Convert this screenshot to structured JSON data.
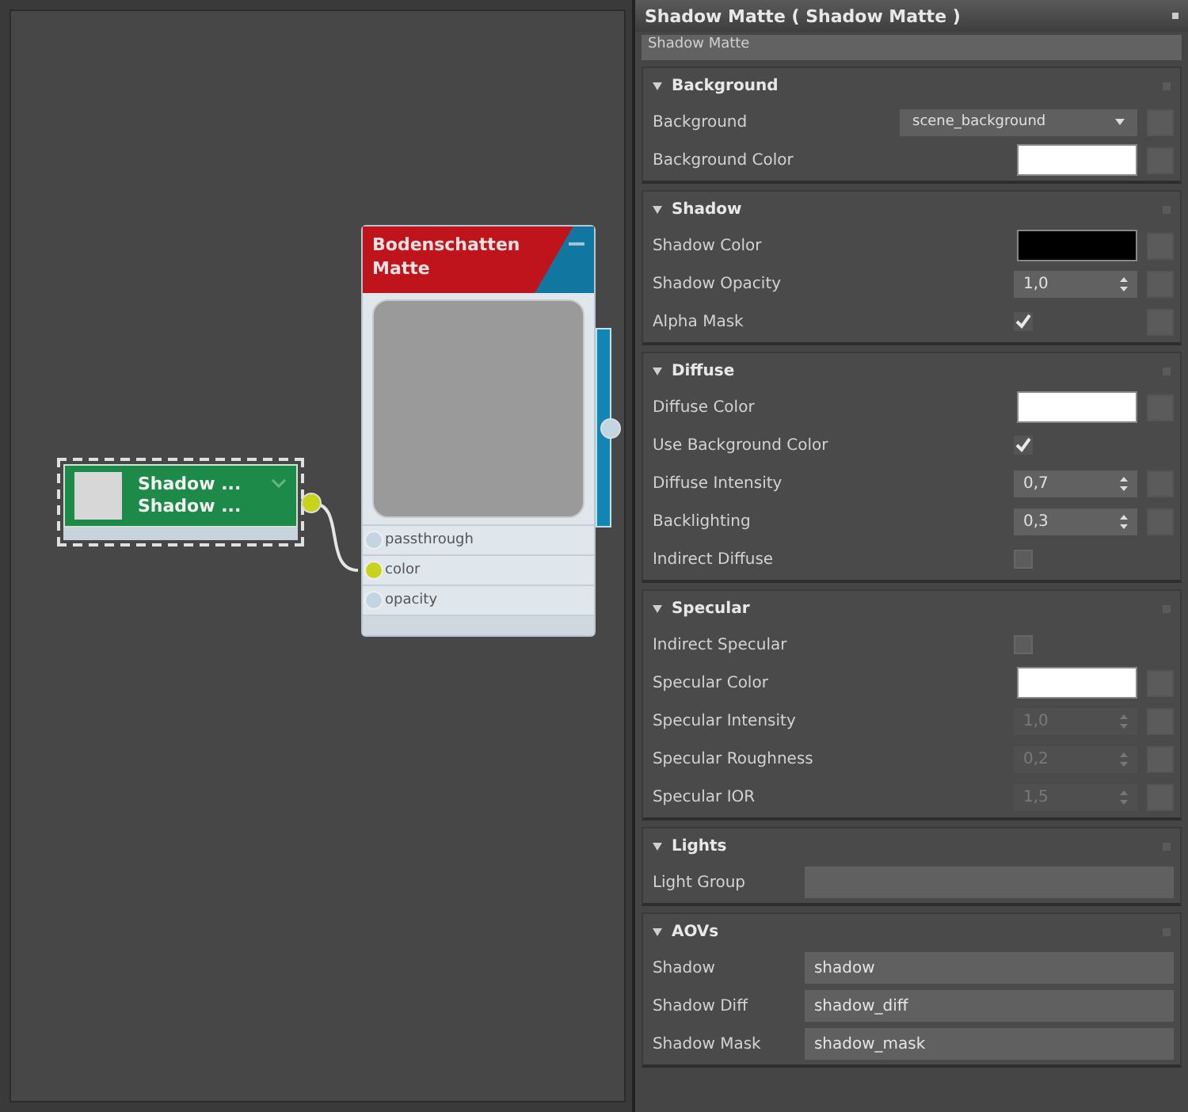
{
  "node_editor": {
    "nodes": [
      {
        "kind": "map",
        "selected": true,
        "lines": [
          "Shadow ...",
          "Shadow ..."
        ]
      },
      {
        "kind": "material",
        "title": "Bodenschatten Matte",
        "ports": [
          {
            "label": "passthrough",
            "connected": false
          },
          {
            "label": "color",
            "connected": true
          },
          {
            "label": "opacity",
            "connected": false
          }
        ]
      }
    ]
  },
  "panel": {
    "title": "Shadow Matte  ( Shadow Matte )",
    "name": "Shadow Matte",
    "sections": [
      {
        "title": "Background",
        "rows": [
          {
            "kind": "dropdown",
            "label": "Background",
            "value": "scene_background",
            "map_slot": true
          },
          {
            "kind": "color",
            "label": "Background Color",
            "color": "#ffffff",
            "map_slot": true
          }
        ]
      },
      {
        "title": "Shadow",
        "rows": [
          {
            "kind": "color",
            "label": "Shadow Color",
            "color": "#000000",
            "map_slot": true
          },
          {
            "kind": "spinner",
            "label": "Shadow Opacity",
            "value": "1,0",
            "disabled": false,
            "map_slot": true
          },
          {
            "kind": "checkbox",
            "label": "Alpha Mask",
            "checked": true,
            "disabled": false,
            "map_slot": true
          }
        ]
      },
      {
        "title": "Diffuse",
        "rows": [
          {
            "kind": "color",
            "label": "Diffuse Color",
            "color": "#ffffff",
            "map_slot": true
          },
          {
            "kind": "checkbox",
            "label": "Use Background Color",
            "checked": true,
            "disabled": false,
            "map_slot": false
          },
          {
            "kind": "spinner",
            "label": "Diffuse Intensity",
            "value": "0,7",
            "disabled": false,
            "map_slot": true
          },
          {
            "kind": "spinner",
            "label": "Backlighting",
            "value": "0,3",
            "disabled": false,
            "map_slot": true
          },
          {
            "kind": "checkbox",
            "label": "Indirect Diffuse",
            "checked": false,
            "disabled": true,
            "map_slot": false
          }
        ]
      },
      {
        "title": "Specular",
        "rows": [
          {
            "kind": "checkbox",
            "label": "Indirect Specular",
            "checked": false,
            "disabled": true,
            "map_slot": false
          },
          {
            "kind": "color",
            "label": "Specular Color",
            "color": "#ffffff",
            "map_slot": true
          },
          {
            "kind": "spinner",
            "label": "Specular Intensity",
            "value": "1,0",
            "disabled": true,
            "map_slot": true
          },
          {
            "kind": "spinner",
            "label": "Specular Roughness",
            "value": "0,2",
            "disabled": true,
            "map_slot": true
          },
          {
            "kind": "spinner",
            "label": "Specular IOR",
            "value": "1,5",
            "disabled": true,
            "map_slot": true
          }
        ]
      },
      {
        "title": "Lights",
        "rows": [
          {
            "kind": "text",
            "label": "Light Group"
          }
        ]
      },
      {
        "title": "AOVs",
        "rows": [
          {
            "kind": "text",
            "label": "Shadow",
            "value": "shadow"
          },
          {
            "kind": "text",
            "label": "Shadow Diff",
            "value": "shadow_diff"
          },
          {
            "kind": "text",
            "label": "Shadow Mask",
            "value": "shadow_mask"
          }
        ]
      }
    ]
  }
}
